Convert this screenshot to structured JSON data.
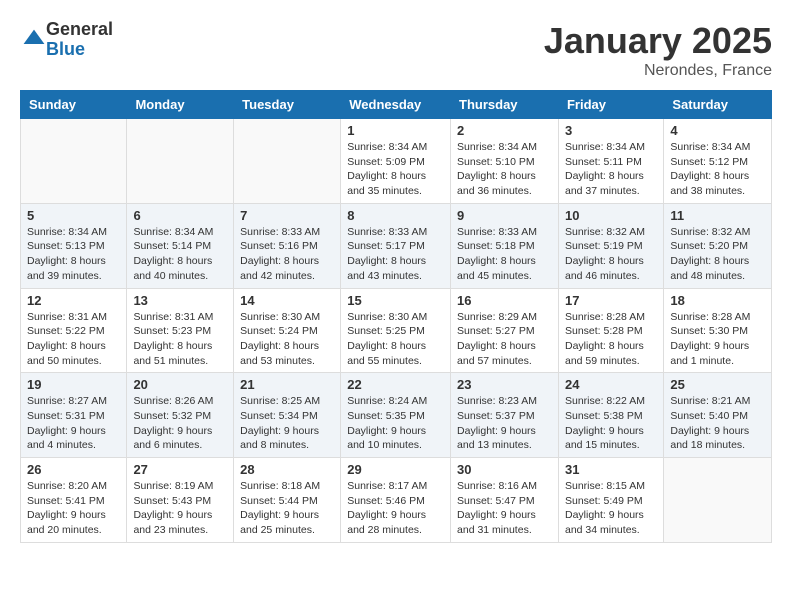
{
  "logo": {
    "general": "General",
    "blue": "Blue"
  },
  "title": "January 2025",
  "location": "Nerondes, France",
  "days_of_week": [
    "Sunday",
    "Monday",
    "Tuesday",
    "Wednesday",
    "Thursday",
    "Friday",
    "Saturday"
  ],
  "weeks": [
    [
      {
        "day": "",
        "info": ""
      },
      {
        "day": "",
        "info": ""
      },
      {
        "day": "",
        "info": ""
      },
      {
        "day": "1",
        "info": "Sunrise: 8:34 AM\nSunset: 5:09 PM\nDaylight: 8 hours and 35 minutes."
      },
      {
        "day": "2",
        "info": "Sunrise: 8:34 AM\nSunset: 5:10 PM\nDaylight: 8 hours and 36 minutes."
      },
      {
        "day": "3",
        "info": "Sunrise: 8:34 AM\nSunset: 5:11 PM\nDaylight: 8 hours and 37 minutes."
      },
      {
        "day": "4",
        "info": "Sunrise: 8:34 AM\nSunset: 5:12 PM\nDaylight: 8 hours and 38 minutes."
      }
    ],
    [
      {
        "day": "5",
        "info": "Sunrise: 8:34 AM\nSunset: 5:13 PM\nDaylight: 8 hours and 39 minutes."
      },
      {
        "day": "6",
        "info": "Sunrise: 8:34 AM\nSunset: 5:14 PM\nDaylight: 8 hours and 40 minutes."
      },
      {
        "day": "7",
        "info": "Sunrise: 8:33 AM\nSunset: 5:16 PM\nDaylight: 8 hours and 42 minutes."
      },
      {
        "day": "8",
        "info": "Sunrise: 8:33 AM\nSunset: 5:17 PM\nDaylight: 8 hours and 43 minutes."
      },
      {
        "day": "9",
        "info": "Sunrise: 8:33 AM\nSunset: 5:18 PM\nDaylight: 8 hours and 45 minutes."
      },
      {
        "day": "10",
        "info": "Sunrise: 8:32 AM\nSunset: 5:19 PM\nDaylight: 8 hours and 46 minutes."
      },
      {
        "day": "11",
        "info": "Sunrise: 8:32 AM\nSunset: 5:20 PM\nDaylight: 8 hours and 48 minutes."
      }
    ],
    [
      {
        "day": "12",
        "info": "Sunrise: 8:31 AM\nSunset: 5:22 PM\nDaylight: 8 hours and 50 minutes."
      },
      {
        "day": "13",
        "info": "Sunrise: 8:31 AM\nSunset: 5:23 PM\nDaylight: 8 hours and 51 minutes."
      },
      {
        "day": "14",
        "info": "Sunrise: 8:30 AM\nSunset: 5:24 PM\nDaylight: 8 hours and 53 minutes."
      },
      {
        "day": "15",
        "info": "Sunrise: 8:30 AM\nSunset: 5:25 PM\nDaylight: 8 hours and 55 minutes."
      },
      {
        "day": "16",
        "info": "Sunrise: 8:29 AM\nSunset: 5:27 PM\nDaylight: 8 hours and 57 minutes."
      },
      {
        "day": "17",
        "info": "Sunrise: 8:28 AM\nSunset: 5:28 PM\nDaylight: 8 hours and 59 minutes."
      },
      {
        "day": "18",
        "info": "Sunrise: 8:28 AM\nSunset: 5:30 PM\nDaylight: 9 hours and 1 minute."
      }
    ],
    [
      {
        "day": "19",
        "info": "Sunrise: 8:27 AM\nSunset: 5:31 PM\nDaylight: 9 hours and 4 minutes."
      },
      {
        "day": "20",
        "info": "Sunrise: 8:26 AM\nSunset: 5:32 PM\nDaylight: 9 hours and 6 minutes."
      },
      {
        "day": "21",
        "info": "Sunrise: 8:25 AM\nSunset: 5:34 PM\nDaylight: 9 hours and 8 minutes."
      },
      {
        "day": "22",
        "info": "Sunrise: 8:24 AM\nSunset: 5:35 PM\nDaylight: 9 hours and 10 minutes."
      },
      {
        "day": "23",
        "info": "Sunrise: 8:23 AM\nSunset: 5:37 PM\nDaylight: 9 hours and 13 minutes."
      },
      {
        "day": "24",
        "info": "Sunrise: 8:22 AM\nSunset: 5:38 PM\nDaylight: 9 hours and 15 minutes."
      },
      {
        "day": "25",
        "info": "Sunrise: 8:21 AM\nSunset: 5:40 PM\nDaylight: 9 hours and 18 minutes."
      }
    ],
    [
      {
        "day": "26",
        "info": "Sunrise: 8:20 AM\nSunset: 5:41 PM\nDaylight: 9 hours and 20 minutes."
      },
      {
        "day": "27",
        "info": "Sunrise: 8:19 AM\nSunset: 5:43 PM\nDaylight: 9 hours and 23 minutes."
      },
      {
        "day": "28",
        "info": "Sunrise: 8:18 AM\nSunset: 5:44 PM\nDaylight: 9 hours and 25 minutes."
      },
      {
        "day": "29",
        "info": "Sunrise: 8:17 AM\nSunset: 5:46 PM\nDaylight: 9 hours and 28 minutes."
      },
      {
        "day": "30",
        "info": "Sunrise: 8:16 AM\nSunset: 5:47 PM\nDaylight: 9 hours and 31 minutes."
      },
      {
        "day": "31",
        "info": "Sunrise: 8:15 AM\nSunset: 5:49 PM\nDaylight: 9 hours and 34 minutes."
      },
      {
        "day": "",
        "info": ""
      }
    ]
  ]
}
